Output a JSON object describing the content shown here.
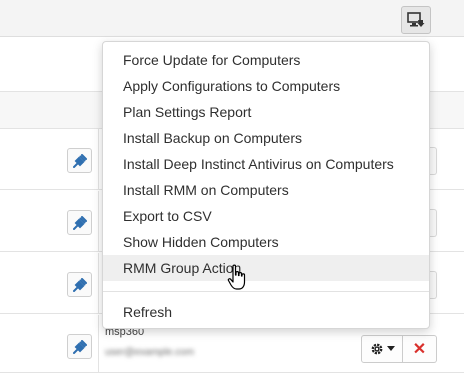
{
  "toolbar": {
    "actions_icon": "computer-actions-icon"
  },
  "dropdown": {
    "items": [
      {
        "label": "Force Update for Computers"
      },
      {
        "label": "Apply Configurations to Computers"
      },
      {
        "label": "Plan Settings Report"
      },
      {
        "label": "Install Backup on Computers"
      },
      {
        "label": "Install Deep Instinct Antivirus on Computers"
      },
      {
        "label": "Install RMM on Computers"
      },
      {
        "label": "Export to CSV"
      },
      {
        "label": "Show Hidden Computers"
      },
      {
        "label": "RMM Group Action",
        "hovered": true
      }
    ],
    "refresh_label": "Refresh"
  },
  "rows": [
    {
      "plug_icon": "plug-icon"
    },
    {
      "plug_icon": "plug-icon"
    },
    {
      "plug_icon": "plug-icon"
    },
    {
      "plug_icon": "plug-icon",
      "company": "msp360",
      "email": "user@example.com",
      "gear_icon": "gear-icon",
      "delete_icon": "close-icon"
    }
  ],
  "colors": {
    "plug_blue": "#2f6fb0",
    "delete_red": "#d9302c",
    "hover_bg": "#efefef"
  }
}
